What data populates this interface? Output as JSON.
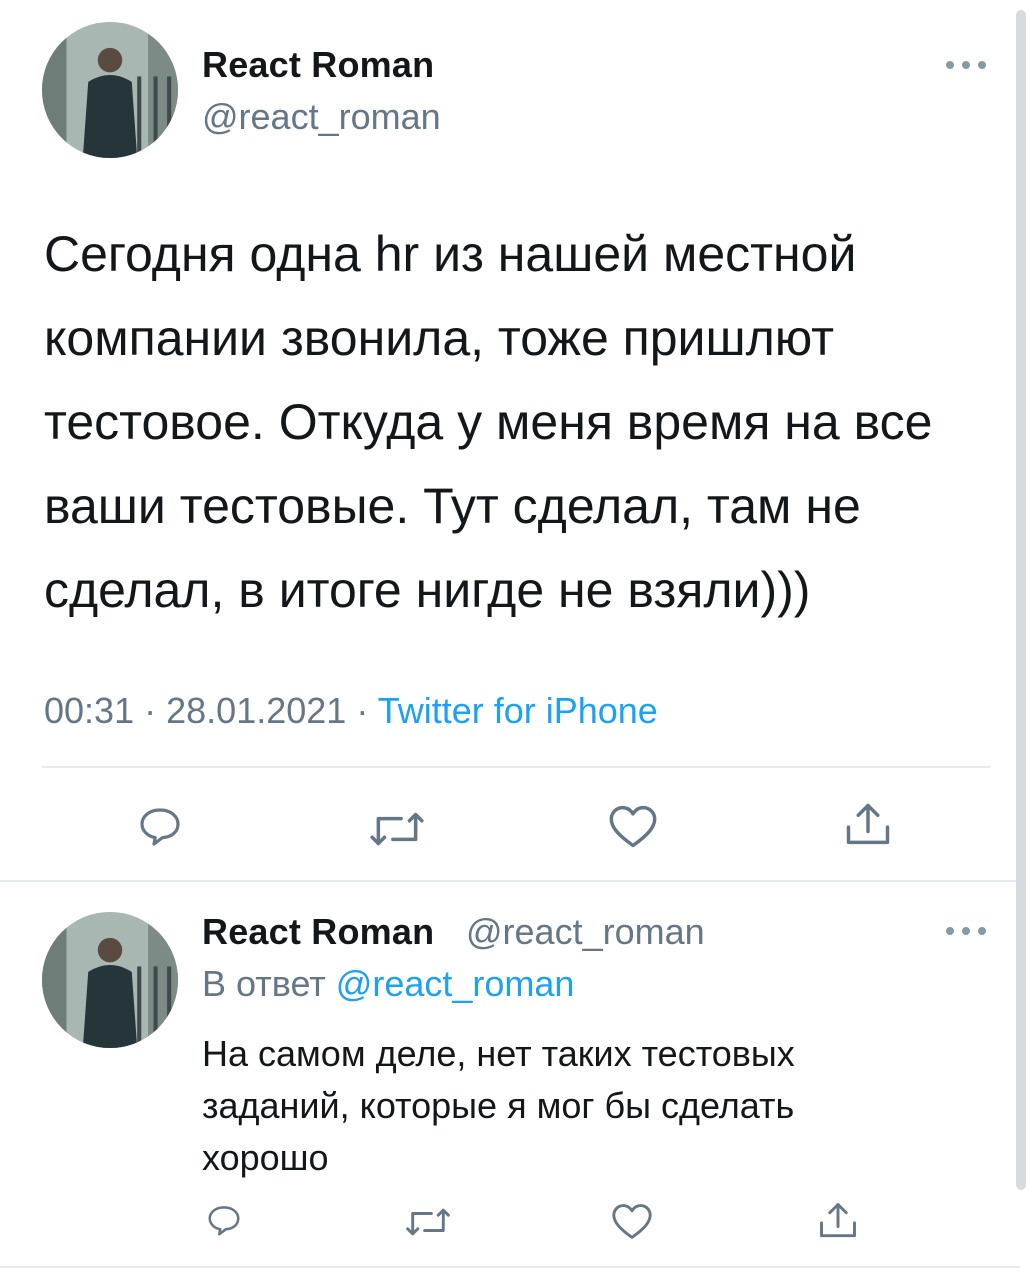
{
  "main_tweet": {
    "author_name": "React Roman",
    "author_handle": "@react_roman",
    "text": "Сегодня одна hr из нашей местной компании звонила, тоже пришлют тестовое. Откуда у меня время на все ваши тестовые. Тут сделал, там не сделал, в итоге нигде не взяли)))",
    "time": "00:31",
    "date": "28.01.2021",
    "separator": "·",
    "source": "Twitter for iPhone"
  },
  "reply_tweet": {
    "author_name": "React Roman",
    "author_handle": "@react_roman",
    "reply_prefix": "В ответ",
    "reply_mention": "@react_roman",
    "text": "На самом деле, нет таких тестовых заданий, которые я мог бы сделать хорошо"
  },
  "actions": [
    "reply-icon",
    "retweet-icon",
    "like-icon",
    "share-icon"
  ],
  "colors": {
    "text": "#14171a",
    "secondary": "#657786",
    "link": "#1da1f2",
    "divider": "#e6ecf0",
    "icon": "#657786"
  }
}
